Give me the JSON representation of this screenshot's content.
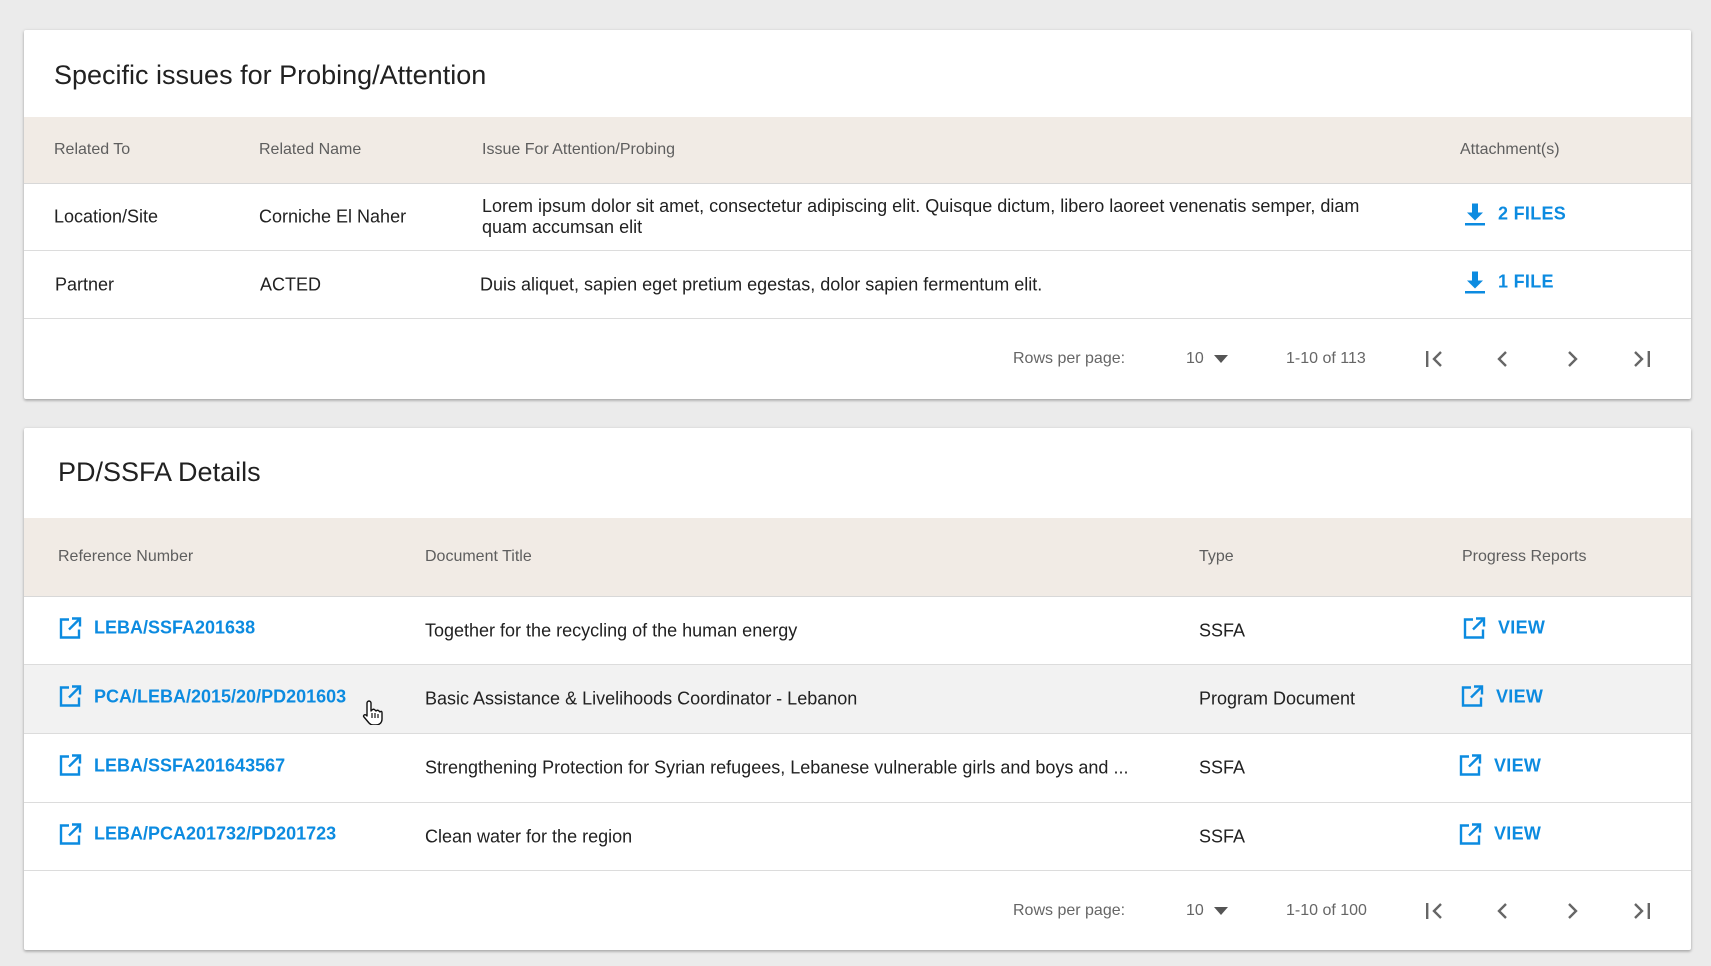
{
  "issues": {
    "title": "Specific issues for Probing/Attention",
    "headers": {
      "related_to": "Related To",
      "related_name": "Related Name",
      "issue": "Issue For Attention/Probing",
      "attachments": "Attachment(s)"
    },
    "rows": [
      {
        "related_to": "Location/Site",
        "related_name": "Corniche El Naher",
        "issue": "Lorem ipsum dolor sit amet, consectetur adipiscing elit. Quisque dictum, libero laoreet venenatis semper, diam quam accumsan elit",
        "attachments": "2 FILES"
      },
      {
        "related_to": "Partner",
        "related_name": "ACTED",
        "issue": "Duis aliquet, sapien eget pretium egestas, dolor sapien fermentum elit.",
        "attachments": "1 FILE"
      }
    ],
    "pagination": {
      "rows_per_page_label": "Rows per page:",
      "rows_per_page": "10",
      "range": "1-10 of 113"
    }
  },
  "pd_ssfa": {
    "title": "PD/SSFA Details",
    "headers": {
      "reference": "Reference Number",
      "title": "Document Title",
      "type": "Type",
      "progress": "Progress Reports"
    },
    "rows": [
      {
        "reference": "LEBA/SSFA201638",
        "title": "Together for the recycling of the human energy",
        "type": "SSFA",
        "progress": "VIEW"
      },
      {
        "reference": "PCA/LEBA/2015/20/PD201603",
        "title": "Basic Assistance & Livelihoods Coordinator - Lebanon",
        "type": "Program Document",
        "progress": "VIEW"
      },
      {
        "reference": "LEBA/SSFA201643567",
        "title": "Strengthening Protection for Syrian refugees, Lebanese vulnerable girls and boys and ...",
        "type": "SSFA",
        "progress": "VIEW"
      },
      {
        "reference": "LEBA/PCA201732/PD201723",
        "title": "Clean water for the region",
        "type": "SSFA",
        "progress": "VIEW"
      }
    ],
    "pagination": {
      "rows_per_page_label": "Rows per page:",
      "rows_per_page": "10",
      "range": "1-10 of 100"
    }
  },
  "colors": {
    "link": "#0c8be0",
    "header_bg": "#f1ebe5",
    "page_bg": "#ebebeb",
    "hover_row": "#f2f2f2"
  },
  "icons": {
    "download": "download-icon",
    "open_external": "open-in-new-icon",
    "dropdown": "arrow-drop-down-icon",
    "first_page": "first-page-icon",
    "prev_page": "chevron-left-icon",
    "next_page": "chevron-right-icon",
    "last_page": "last-page-icon",
    "cursor": "hand-pointer-icon"
  }
}
